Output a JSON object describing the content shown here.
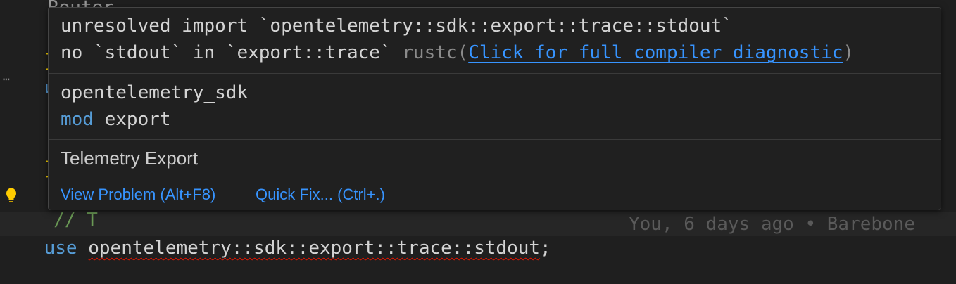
{
  "editor": {
    "partial_top": "Router",
    "lines": {
      "line1_brace": "}",
      "line1_semi": ";",
      "line2_kw": "use",
      "line3_dots": "⋯",
      "line4_brace": "}",
      "line4_semi": ";",
      "line5_comment": "// T",
      "current_kw": "use",
      "current_path": "opentelemetry::sdk::export::trace::stdout",
      "current_semi": ";",
      "blame": "You, 6 days ago • Barebone"
    }
  },
  "hover": {
    "error_line1": "unresolved import `opentelemetry::sdk::export::trace::stdout`",
    "error_line2_prefix": "no `stdout` in `export::trace` ",
    "error_source": "rustc",
    "paren_open": "(",
    "diagnostic_link": "Click for full compiler diagnostic",
    "paren_close": ")",
    "crate_name": "opentelemetry_sdk",
    "mod_keyword": "mod",
    "mod_name": "export",
    "doc_text": "Telemetry Export",
    "actions": {
      "view_problem": "View Problem (Alt+F8)",
      "quick_fix": "Quick Fix... (Ctrl+.)"
    }
  },
  "colors": {
    "background": "#1f1f1f",
    "keyword": "#569cd6",
    "brace": "#ffd700",
    "link": "#3794ff",
    "error_squiggle": "#e51400",
    "bulb": "#ffcc00"
  }
}
